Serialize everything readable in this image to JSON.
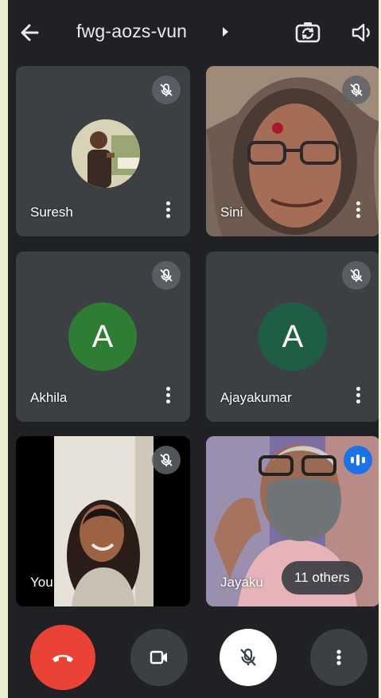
{
  "header": {
    "meeting_code": "fwg-aozs-vun"
  },
  "participants": [
    {
      "name": "Suresh",
      "muted": true,
      "type": "photo"
    },
    {
      "name": "Sini",
      "muted": true,
      "type": "video"
    },
    {
      "name": "Akhila",
      "muted": true,
      "type": "avatar",
      "initial": "A",
      "color": "#2e7d32"
    },
    {
      "name": "Ajayakumar",
      "muted": true,
      "type": "avatar",
      "initial": "A",
      "color": "#1e5e45"
    },
    {
      "name": "You",
      "muted": true,
      "type": "video"
    },
    {
      "name": "Jayaku",
      "muted": false,
      "type": "video",
      "speaking": true
    }
  ],
  "others_chip": "11 others",
  "colors": {
    "end_call": "#ea4335",
    "speaking": "#1a73e8",
    "tile": "#3c4043",
    "background": "#202124"
  },
  "controls": {
    "end_call": "end-call-icon",
    "camera": "video-camera-icon",
    "microphone": "mic-off-icon",
    "more": "more-vertical-icon"
  }
}
